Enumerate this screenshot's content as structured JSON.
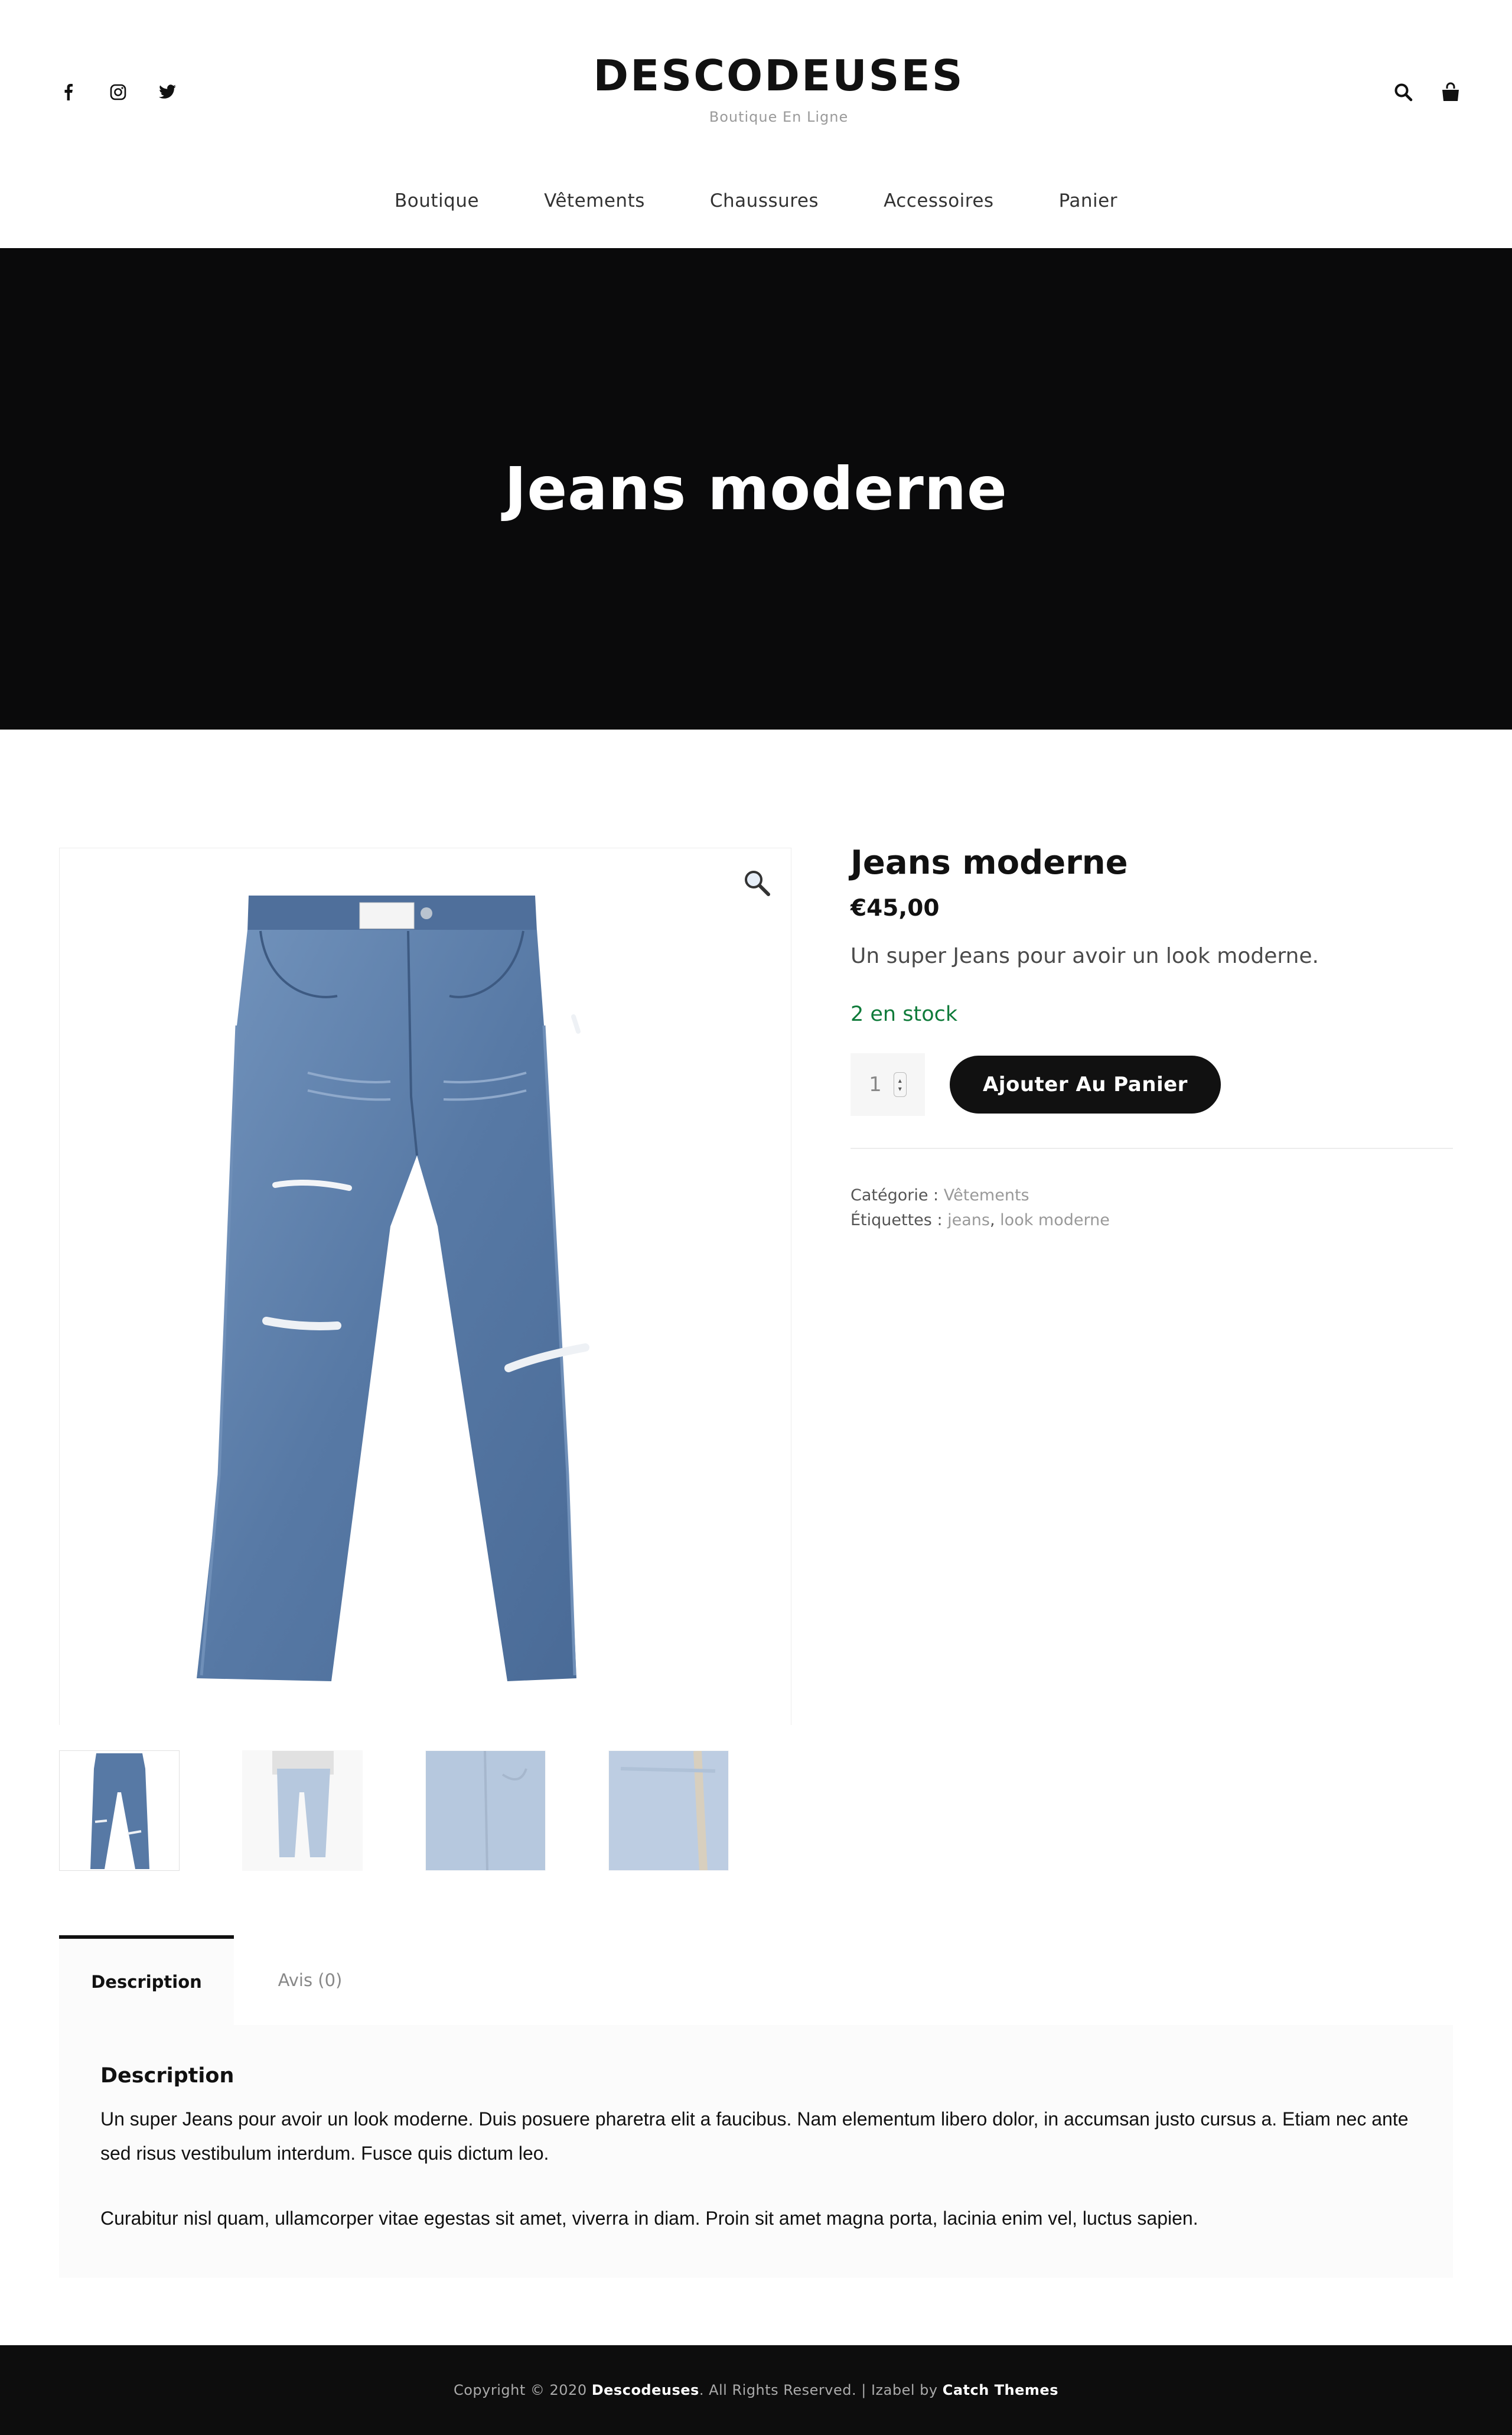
{
  "header": {
    "site_title": "DESCODEUSES",
    "tagline": "Boutique En Ligne",
    "social_icons": [
      "facebook-icon",
      "instagram-icon",
      "twitter-icon"
    ],
    "action_icons": [
      "search-icon",
      "cart-icon"
    ]
  },
  "nav": {
    "items": [
      "Boutique",
      "Vêtements",
      "Chaussures",
      "Accessoires",
      "Panier"
    ]
  },
  "hero": {
    "title": "Jeans moderne"
  },
  "product": {
    "title": "Jeans moderne",
    "price": "€45,00",
    "short_description": "Un super Jeans pour avoir un look moderne.",
    "stock": "2 en stock",
    "quantity": "1",
    "add_to_cart": "Ajouter Au Panier",
    "category_label": "Catégorie :",
    "category_value": "Vêtements",
    "tags_label": "Étiquettes :",
    "tag_1": "jeans",
    "tag_sep": ",",
    "tag_2": "look moderne",
    "zoom_icon": "magnifier-icon"
  },
  "tabs": {
    "items": [
      "Description",
      "Avis (0)"
    ],
    "active": "Description"
  },
  "description": {
    "heading": "Description",
    "paragraph_1": "Un super Jeans pour avoir un look moderne. Duis posuere pharetra elit a faucibus. Nam elementum libero dolor, in accumsan justo cursus a. Etiam nec ante sed risus vestibulum interdum. Fusce quis dictum leo.",
    "paragraph_2": "Curabitur nisl quam, ullamcorper vitae egestas sit amet, viverra in diam. Proin sit amet magna porta, lacinia enim vel, luctus sapien."
  },
  "footer": {
    "copyright_prefix": "Copyright © 2020",
    "brand": "Descodeuses",
    "rights": ". All Rights Reserved. | Izabel by",
    "theme": "Catch Themes"
  },
  "colors": {
    "hero_bg": "#0a0a0b",
    "stock_green": "#0f7b3a",
    "button_bg": "#111111",
    "denim": "#5b7fa8"
  }
}
